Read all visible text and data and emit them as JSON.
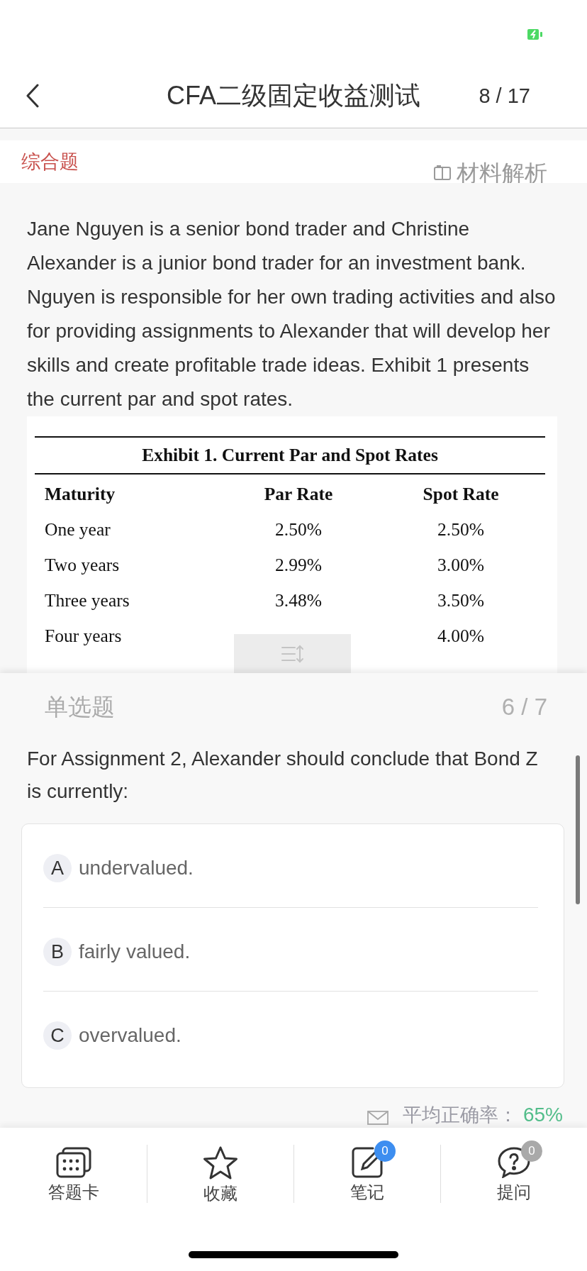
{
  "header": {
    "title": "CFA二级固定收益测试",
    "progress": "8 / 17"
  },
  "section": {
    "label": "综合题",
    "material_link": "材料解析"
  },
  "passage": {
    "text": "Jane Nguyen is a senior bond trader and Christine Alexander is a junior bond trader for an investment bank. Nguyen is responsible for her own trading activities and also for providing assignments to Alexander that will develop her skills and create profitable trade ideas. Exhibit 1 presents the current par and spot rates.",
    "exhibit": {
      "title": "Exhibit 1. Current Par and Spot Rates",
      "columns": [
        "Maturity",
        "Par Rate",
        "Spot Rate"
      ],
      "rows": [
        {
          "maturity": "One year",
          "par_rate": "2.50%",
          "spot_rate": "2.50%"
        },
        {
          "maturity": "Two years",
          "par_rate": "2.99%",
          "spot_rate": "3.00%"
        },
        {
          "maturity": "Three years",
          "par_rate": "3.48%",
          "spot_rate": "3.50%"
        },
        {
          "maturity": "Four years",
          "spot_rate": "4.00%"
        }
      ]
    }
  },
  "question": {
    "type": "单选题",
    "progress": "6 / 7",
    "text": "For Assignment 2, Alexander should conclude that Bond Z is currently:",
    "options": [
      {
        "letter": "A",
        "text": "undervalued.",
        "selected": false
      },
      {
        "letter": "B",
        "text": "fairly valued.",
        "selected": false
      },
      {
        "letter": "C",
        "text": "overvalued.",
        "selected": false
      }
    ]
  },
  "stats": {
    "label": "平均正确率：",
    "value": "65%"
  },
  "tab_bar": [
    {
      "kind": "answer_sheet",
      "label": "答题卡"
    },
    {
      "kind": "favorite",
      "label": "收藏"
    },
    {
      "kind": "note",
      "label": "笔记",
      "badge": {
        "count": "0",
        "highlighted": true
      }
    },
    {
      "kind": "ask",
      "label": "提问",
      "badge": {
        "count": "0",
        "highlighted": false
      }
    }
  ]
}
